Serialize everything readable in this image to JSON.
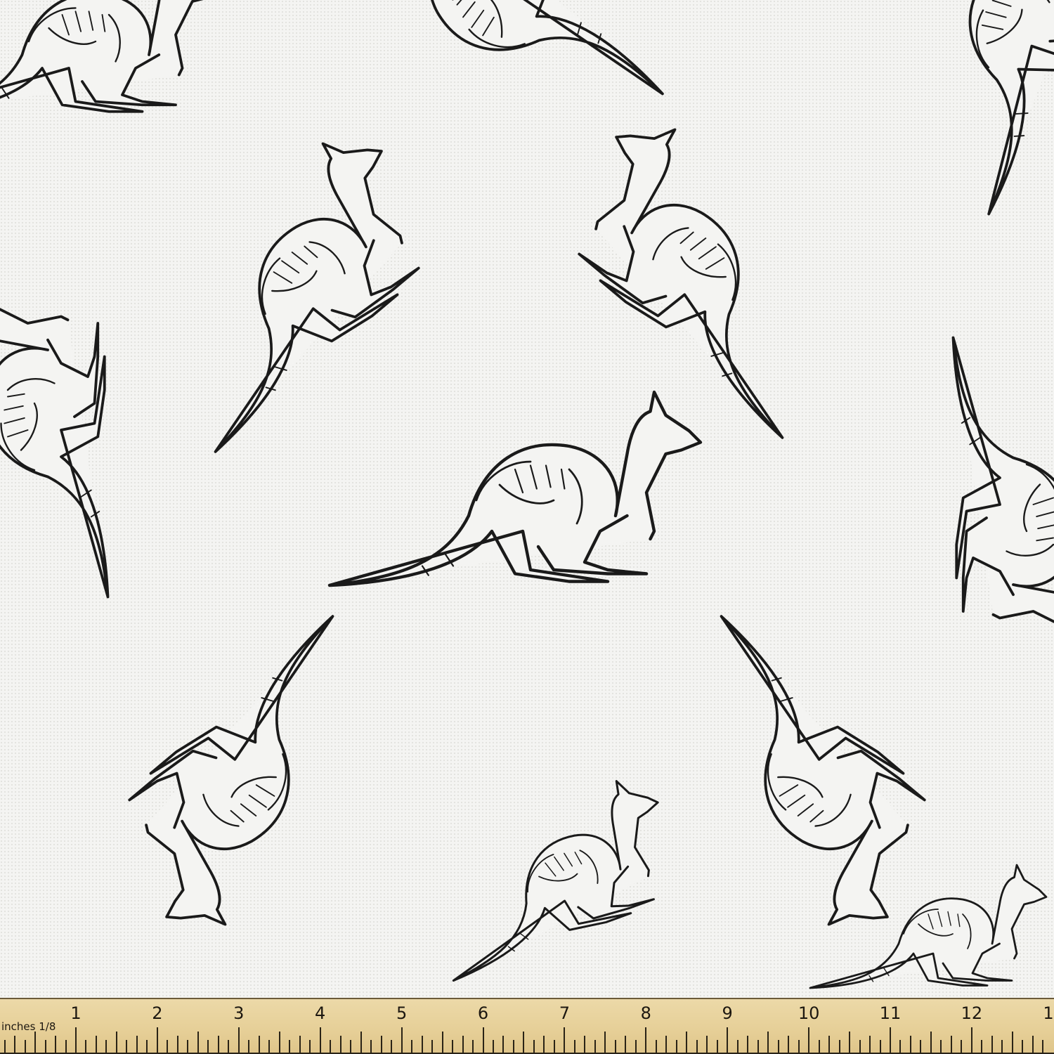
{
  "ruler": {
    "unit_label": "inches 1/8",
    "numbers": [
      "1",
      "2",
      "3",
      "4",
      "5",
      "6",
      "7",
      "8",
      "9",
      "10",
      "11",
      "12",
      "1"
    ]
  },
  "pattern": {
    "subject": "kangaroo",
    "ink_color": "#1a1a1a",
    "background_color": "#f4f4f2"
  }
}
